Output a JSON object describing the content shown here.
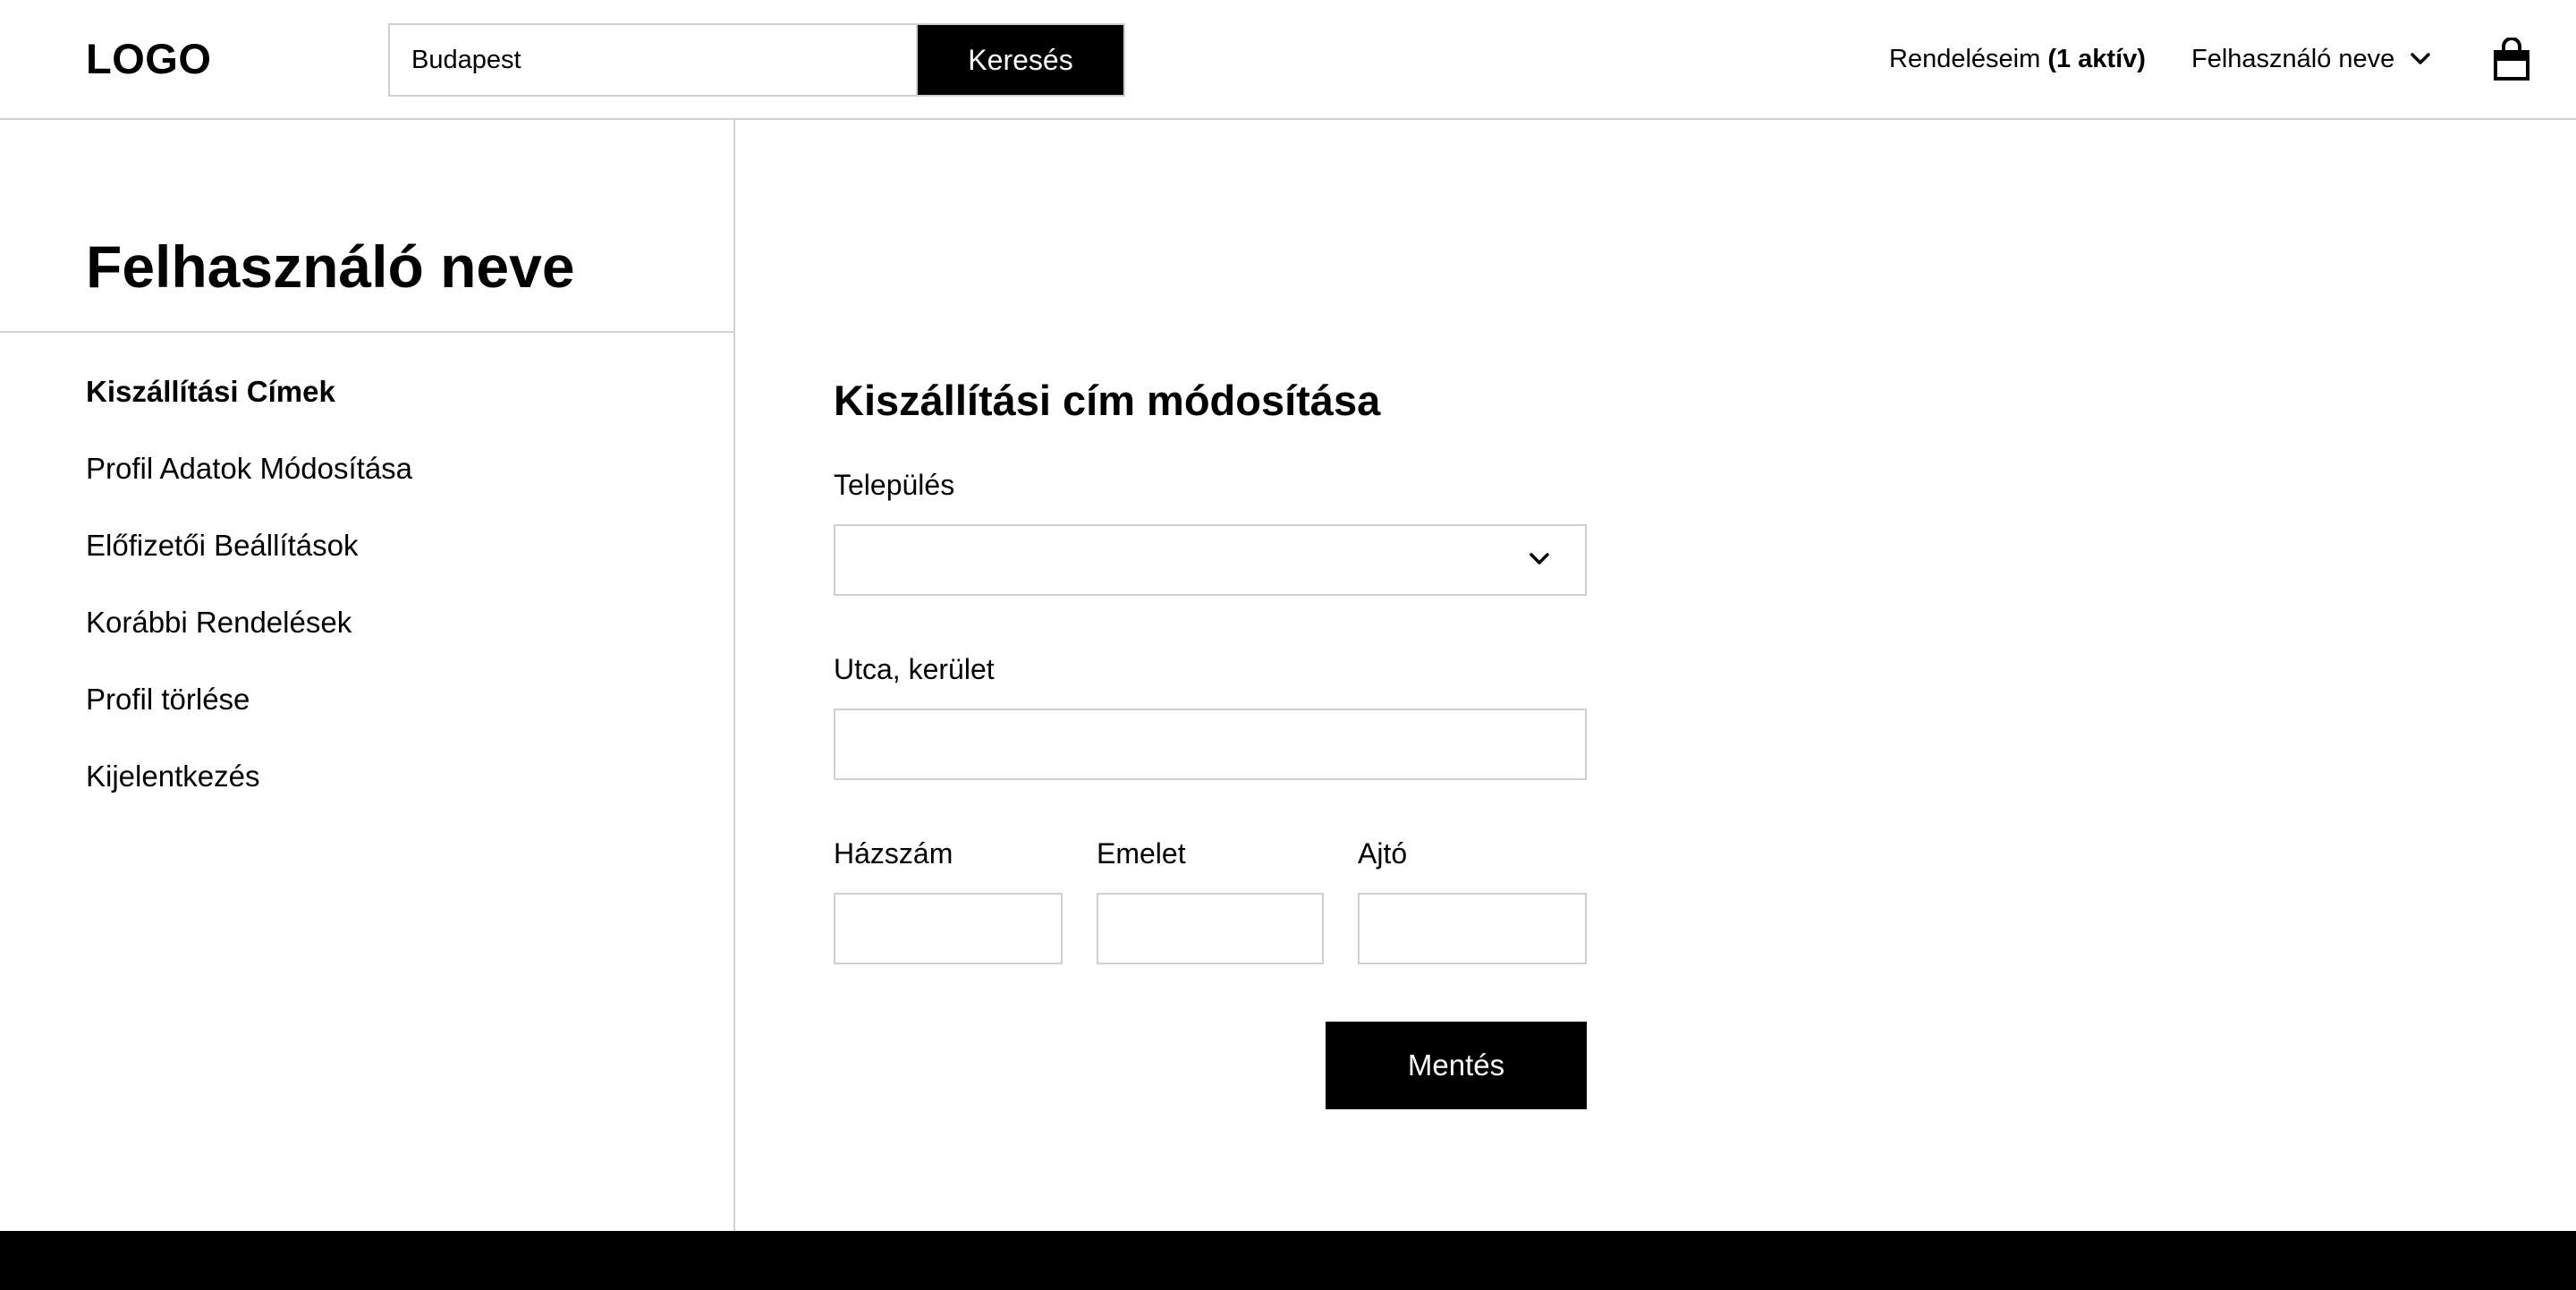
{
  "header": {
    "logo": "LOGO",
    "search": {
      "value": "Budapest",
      "button_label": "Keresés"
    },
    "orders": {
      "label": "Rendeléseim",
      "active": "(1 aktív)"
    },
    "user_menu": {
      "label": "Felhasználó neve",
      "icon": "chevron-down-icon"
    },
    "cart_icon": "shopping-bag-icon"
  },
  "sidebar": {
    "title": "Felhasználó neve",
    "items": [
      {
        "label": "Kiszállítási Címek",
        "active": true
      },
      {
        "label": "Profil Adatok Módosítása",
        "active": false
      },
      {
        "label": "Előfizetői Beállítások",
        "active": false
      },
      {
        "label": "Korábbi Rendelések",
        "active": false
      },
      {
        "label": "Profil törlése",
        "active": false
      },
      {
        "label": "Kijelentkezés",
        "active": false
      }
    ]
  },
  "form": {
    "title": "Kiszállítási cím módosítása",
    "settlement": {
      "label": "Település",
      "value": ""
    },
    "street": {
      "label": "Utca, kerület",
      "value": ""
    },
    "house_number": {
      "label": "Házszám",
      "value": ""
    },
    "floor": {
      "label": "Emelet",
      "value": ""
    },
    "door": {
      "label": "Ajtó",
      "value": ""
    },
    "save_label": "Mentés"
  },
  "colors": {
    "primary": "#000000",
    "background": "#ffffff",
    "border": "#cfcfcf"
  }
}
